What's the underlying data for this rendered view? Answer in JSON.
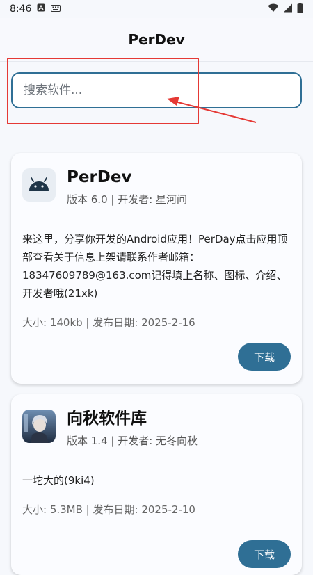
{
  "status_bar": {
    "time": "8:46"
  },
  "app_bar": {
    "title": "PerDev"
  },
  "search": {
    "placeholder": "搜索软件..."
  },
  "apps": [
    {
      "name": "PerDev",
      "version_line": "版本 6.0 | 开发者: 星河间",
      "description": "来这里，分享你开发的Android应用！PerDay点击应用顶部查看关于信息上架请联系作者邮箱：18347609789@163.com记得填上名称、图标、介绍、开发者哦(21xk)",
      "info_line": "大小: 140kb | 发布日期: 2025-2-16",
      "download_label": "下载",
      "icon": "android-icon"
    },
    {
      "name": "向秋软件库",
      "version_line": "版本 1.4 | 开发者: 无冬向秋",
      "description": "一坨大的(9ki4)",
      "info_line": "大小: 5.3MB | 发布日期: 2025-2-10",
      "download_label": "下载",
      "icon": "avatar-icon"
    }
  ],
  "colors": {
    "accent": "#2f6f95",
    "annotation": "#e53935"
  }
}
